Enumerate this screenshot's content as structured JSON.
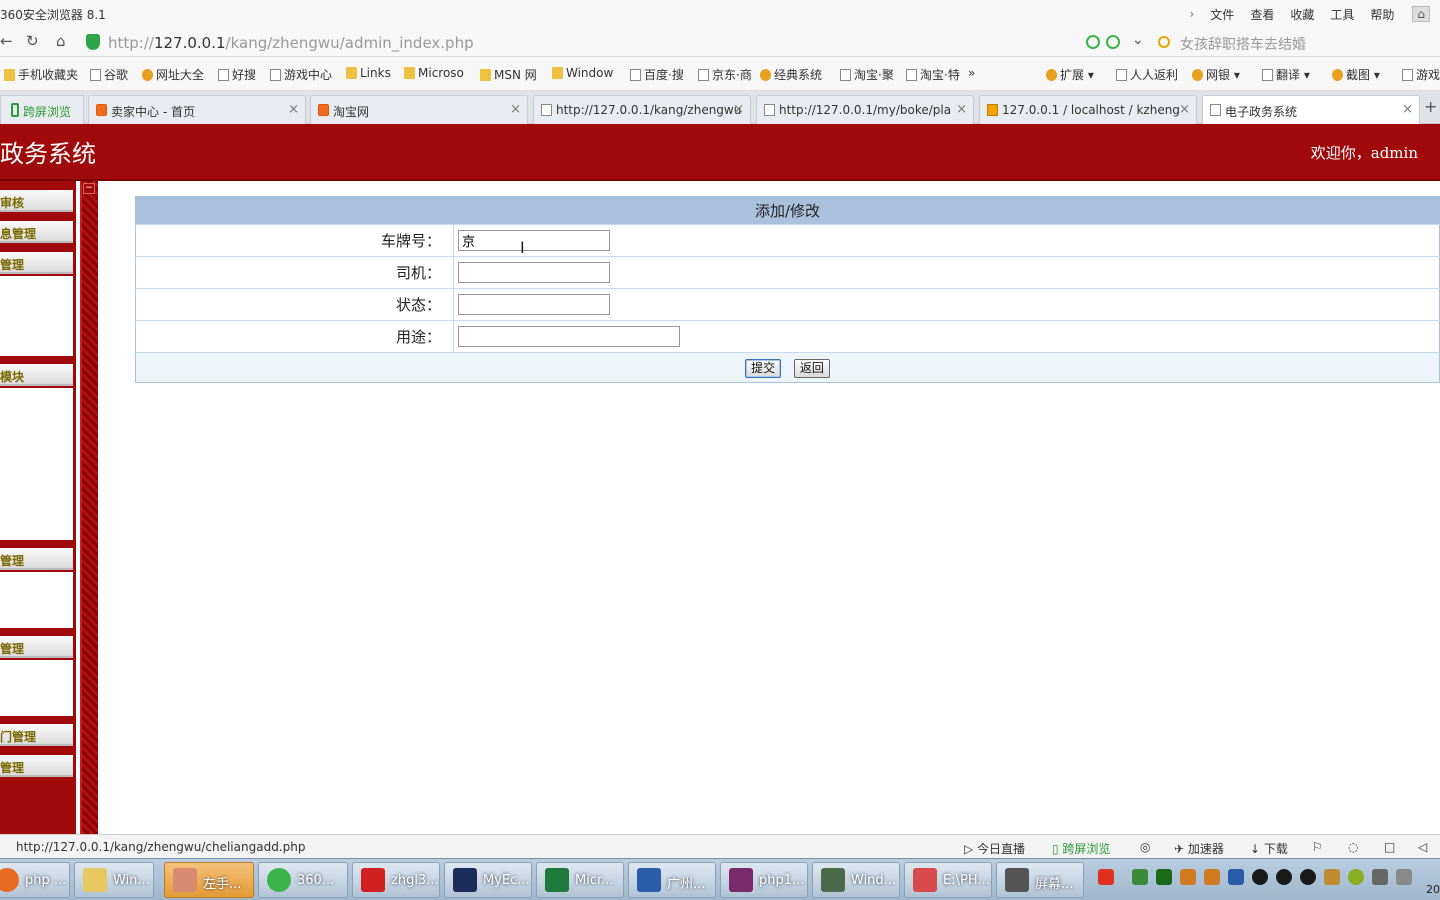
{
  "browser": {
    "app_title": "360安全浏览器 8.1",
    "menu": [
      "文件",
      "查看",
      "收藏",
      "工具",
      "帮助"
    ],
    "address_prefix": "http://",
    "address_host": "127.0.0.1",
    "address_path": "/kang/zhengwu/admin_index.php",
    "search_placeholder": "女孩辞职搭车去结婚",
    "bookmarks": [
      "手机收藏夹",
      "谷歌",
      "网址大全",
      "好搜",
      "游戏中心",
      "Links",
      "Microso",
      "MSN 网",
      "Window",
      "百度·搜",
      "京东·商",
      "经典系统",
      "淘宝·聚",
      "淘宝·特",
      "扩展",
      "人人返利",
      "网银",
      "翻译",
      "截图",
      "游戏"
    ],
    "tabs": [
      {
        "label": "跨屏浏览"
      },
      {
        "label": "卖家中心 - 首页"
      },
      {
        "label": "淘宝网"
      },
      {
        "label": "http://127.0.0.1/kang/zhengwu"
      },
      {
        "label": "http://127.0.0.1/my/boke/pla"
      },
      {
        "label": "127.0.0.1 / localhost / kzheng"
      },
      {
        "label": "电子政务系统"
      }
    ]
  },
  "header": {
    "title": "政务系统",
    "welcome": "欢迎你，admin"
  },
  "sidebar": {
    "collapse": "−",
    "items": [
      "审核",
      "息管理",
      "管理",
      "模块",
      "管理",
      "管理",
      "门管理",
      "管理"
    ]
  },
  "form": {
    "title": "添加/修改",
    "fields": [
      {
        "label": "车牌号：",
        "value": ""
      },
      {
        "label": "司机：",
        "value": ""
      },
      {
        "label": "状态：",
        "value": ""
      },
      {
        "label": "用途：",
        "value": ""
      }
    ],
    "plate_value": "京",
    "submit_label": "提交",
    "back_label": "返回"
  },
  "statusbar": {
    "url": "http://127.0.0.1/kang/zhengwu/cheliangadd.php",
    "items": [
      "今日直播",
      "跨屏浏览",
      "加速器",
      "下载"
    ]
  },
  "taskbar": {
    "tasks": [
      "php ...",
      "Win...",
      "左手...",
      "360...",
      "zhgl3...",
      "MyEc...",
      "Micr...",
      "广州...",
      "php1...",
      "Wind...",
      "E:\\PH...",
      "屏幕..."
    ],
    "clock": "20"
  }
}
